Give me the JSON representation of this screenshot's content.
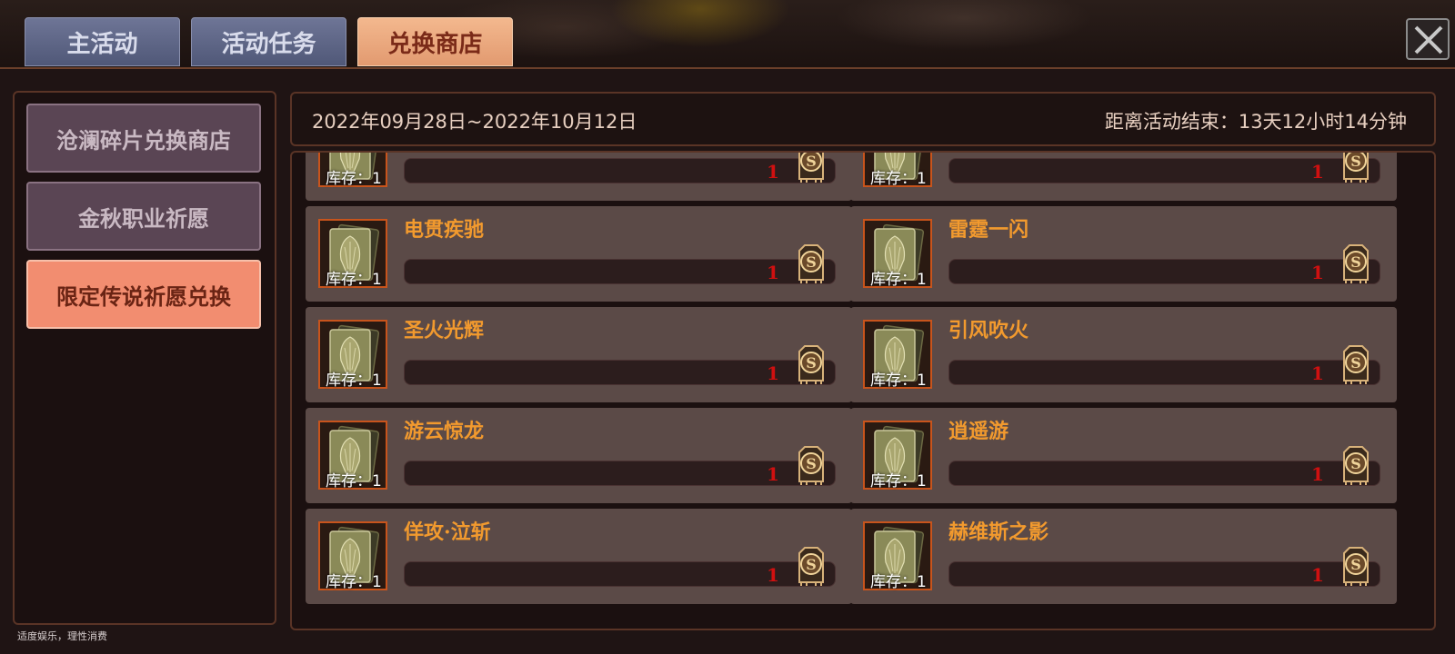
{
  "tabs": [
    {
      "label": "主活动",
      "active": false
    },
    {
      "label": "活动任务",
      "active": false
    },
    {
      "label": "兑换商店",
      "active": true
    }
  ],
  "sidebar": {
    "items": [
      {
        "label": "沧澜碎片兑换商店",
        "active": false
      },
      {
        "label": "金秋职业祈愿",
        "active": false
      },
      {
        "label": "限定传说祈愿兑换",
        "active": true
      }
    ]
  },
  "header": {
    "date_range": "2022年09月28日~2022年10月12日",
    "countdown": "距离活动结束：13天12小时14分钟"
  },
  "stock_label": "库存：1",
  "items": [
    {
      "name": "",
      "price": "1"
    },
    {
      "name": "",
      "price": "1"
    },
    {
      "name": "电贯疾驰",
      "price": "1"
    },
    {
      "name": "雷霆一闪",
      "price": "1"
    },
    {
      "name": "圣火光辉",
      "price": "1"
    },
    {
      "name": "引风吹火",
      "price": "1"
    },
    {
      "name": "游云惊龙",
      "price": "1"
    },
    {
      "name": "逍遥游",
      "price": "1"
    },
    {
      "name": "佯攻·泣斩",
      "price": "1"
    },
    {
      "name": "赫维斯之影",
      "price": "1"
    }
  ],
  "footer": {
    "note": "适度娱乐，理性消费"
  },
  "icons": {
    "close": "close-icon",
    "card": "card-icon",
    "coin": "coin-icon"
  },
  "colors": {
    "accent": "#f28d70",
    "item_name": "#f29a2e",
    "price": "#d01010"
  }
}
